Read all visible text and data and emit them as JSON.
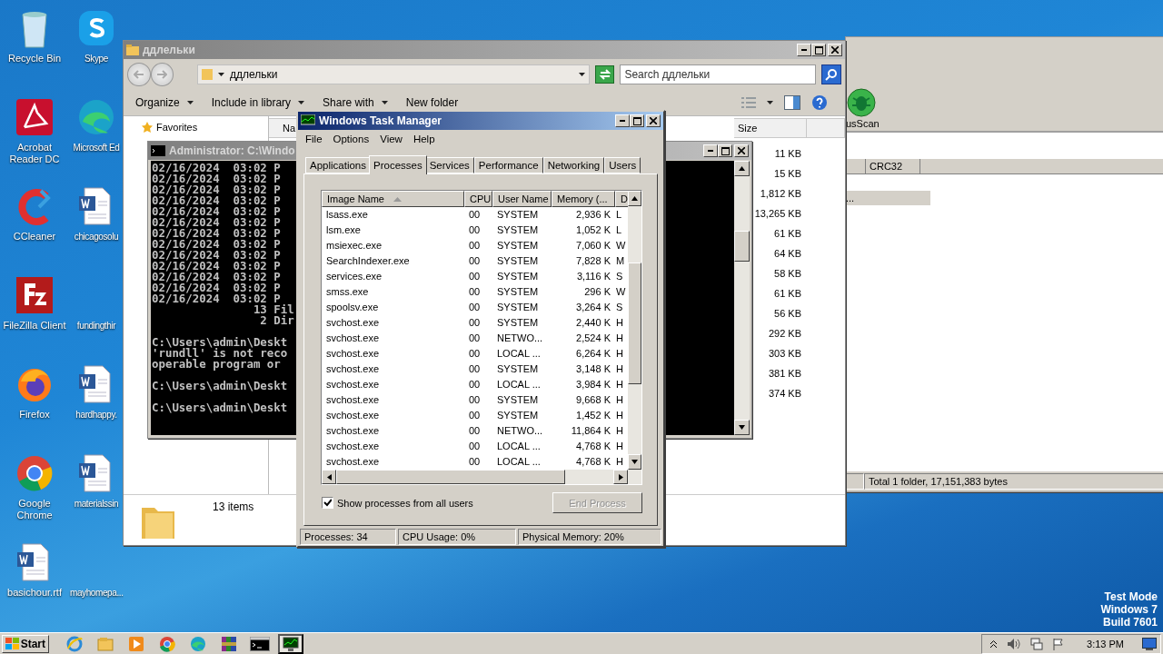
{
  "desktop": {
    "icons": [
      {
        "label": "Recycle Bin",
        "kind": "bin"
      },
      {
        "label": "Skype",
        "kind": "skype"
      },
      {
        "label": "Acrobat Reader DC",
        "kind": "pdf"
      },
      {
        "label": "Microsoft Ed",
        "kind": "edge"
      },
      {
        "label": "CCleaner",
        "kind": "ccleaner"
      },
      {
        "label": "chicagosolu",
        "kind": "doc"
      },
      {
        "label": "FileZilla Client",
        "kind": "filezilla"
      },
      {
        "label": "fundingthir",
        "kind": "none"
      },
      {
        "label": "Firefox",
        "kind": "firefox"
      },
      {
        "label": "hardhappy.",
        "kind": "doc"
      },
      {
        "label": "Google Chrome",
        "kind": "chrome"
      },
      {
        "label": "materialssin",
        "kind": "doc"
      },
      {
        "label": "basichour.rtf",
        "kind": "doc"
      },
      {
        "label": "mayhomepa...",
        "kind": "none"
      }
    ],
    "watermark_lines": [
      "Test Mode",
      "Windows 7",
      "Build 7601"
    ]
  },
  "back_window": {
    "toolbar_label": "usScan",
    "columns": [
      "CRC32"
    ],
    "selected_row": "...",
    "status": "Total 1 folder, 17,151,383 bytes"
  },
  "explorer": {
    "title": "ддлельки",
    "address": "ддлельки",
    "search_placeholder": "Search ддлельки",
    "toolbar": [
      {
        "label": "Organize",
        "dropdown": true
      },
      {
        "label": "Include in library",
        "dropdown": true
      },
      {
        "label": "Share with",
        "dropdown": true
      },
      {
        "label": "New folder",
        "dropdown": false
      }
    ],
    "nav": [
      "Favorites"
    ],
    "columns": [
      "Na",
      "Size"
    ],
    "sizes": [
      "11 KB",
      "15 KB",
      "1,812 KB",
      "13,265 KB",
      "61 KB",
      "64 KB",
      "58 KB",
      "61 KB",
      "56 KB",
      "292 KB",
      "303 KB",
      "381 KB",
      "374 KB"
    ],
    "item_count": "13 items"
  },
  "cmd": {
    "title": "Administrator: C:\\Windo",
    "blocks": [
      [
        "02/16/2024  03:02 P",
        "02/16/2024  03:02 P",
        "02/16/2024  03:02 P",
        "02/16/2024  03:02 P",
        "02/16/2024  03:02 P",
        "02/16/2024  03:02 P",
        "02/16/2024  03:02 P",
        "02/16/2024  03:02 P",
        "02/16/2024  03:02 P",
        "02/16/2024  03:02 P",
        "02/16/2024  03:02 P",
        "02/16/2024  03:02 P",
        "02/16/2024  03:02 P",
        "               13 Fil",
        "                2 Dir"
      ],
      [
        "C:\\Users\\admin\\Deskt",
        "'rundll' is not reco",
        "operable program or"
      ],
      [
        "C:\\Users\\admin\\Deskt"
      ],
      [
        "C:\\Users\\admin\\Deskt"
      ]
    ]
  },
  "task_manager": {
    "title": "Windows Task Manager",
    "menu": [
      "File",
      "Options",
      "View",
      "Help"
    ],
    "tabs": [
      {
        "label": "Applications",
        "selected": false
      },
      {
        "label": "Processes",
        "selected": true
      },
      {
        "label": "Services",
        "selected": false
      },
      {
        "label": "Performance",
        "selected": false
      },
      {
        "label": "Networking",
        "selected": false
      },
      {
        "label": "Users",
        "selected": false
      }
    ],
    "columns": [
      "Image Name",
      "CPU",
      "User Name",
      "Memory (...",
      "D"
    ],
    "rows": [
      [
        "lsass.exe",
        "00",
        "SYSTEM",
        "2,936 K",
        "L"
      ],
      [
        "lsm.exe",
        "00",
        "SYSTEM",
        "1,052 K",
        "L"
      ],
      [
        "msiexec.exe",
        "00",
        "SYSTEM",
        "7,060 K",
        "W"
      ],
      [
        "SearchIndexer.exe",
        "00",
        "SYSTEM",
        "7,828 K",
        "M"
      ],
      [
        "services.exe",
        "00",
        "SYSTEM",
        "3,116 K",
        "S"
      ],
      [
        "smss.exe",
        "00",
        "SYSTEM",
        "296 K",
        "W"
      ],
      [
        "spoolsv.exe",
        "00",
        "SYSTEM",
        "3,264 K",
        "S"
      ],
      [
        "svchost.exe",
        "00",
        "SYSTEM",
        "2,440 K",
        "H"
      ],
      [
        "svchost.exe",
        "00",
        "NETWO...",
        "2,524 K",
        "H"
      ],
      [
        "svchost.exe",
        "00",
        "LOCAL ...",
        "6,264 K",
        "H"
      ],
      [
        "svchost.exe",
        "00",
        "SYSTEM",
        "3,148 K",
        "H"
      ],
      [
        "svchost.exe",
        "00",
        "LOCAL ...",
        "3,984 K",
        "H"
      ],
      [
        "svchost.exe",
        "00",
        "SYSTEM",
        "9,668 K",
        "H"
      ],
      [
        "svchost.exe",
        "00",
        "SYSTEM",
        "1,452 K",
        "H"
      ],
      [
        "svchost.exe",
        "00",
        "NETWO...",
        "11,864 K",
        "H"
      ],
      [
        "svchost.exe",
        "00",
        "LOCAL ...",
        "4,768 K",
        "H"
      ],
      [
        "svchost.exe",
        "00",
        "LOCAL ...",
        "4,768 K",
        "H"
      ]
    ],
    "show_all_users": {
      "label": "Show processes from all users",
      "checked": true
    },
    "end_process": {
      "label": "End Process",
      "disabled": true
    },
    "status": [
      "Processes: 34",
      "CPU Usage: 0%",
      "Physical Memory: 20%"
    ]
  },
  "taskbar": {
    "start": "Start",
    "apps": [
      {
        "kind": "ie",
        "active": false
      },
      {
        "kind": "folder",
        "active": false
      },
      {
        "kind": "media",
        "active": false
      },
      {
        "kind": "chrome",
        "active": false
      },
      {
        "kind": "edge",
        "active": false
      },
      {
        "kind": "archive",
        "active": false
      },
      {
        "kind": "cmd",
        "active": false
      },
      {
        "kind": "taskmgr",
        "active": true
      }
    ],
    "clock": "3:13 PM"
  }
}
